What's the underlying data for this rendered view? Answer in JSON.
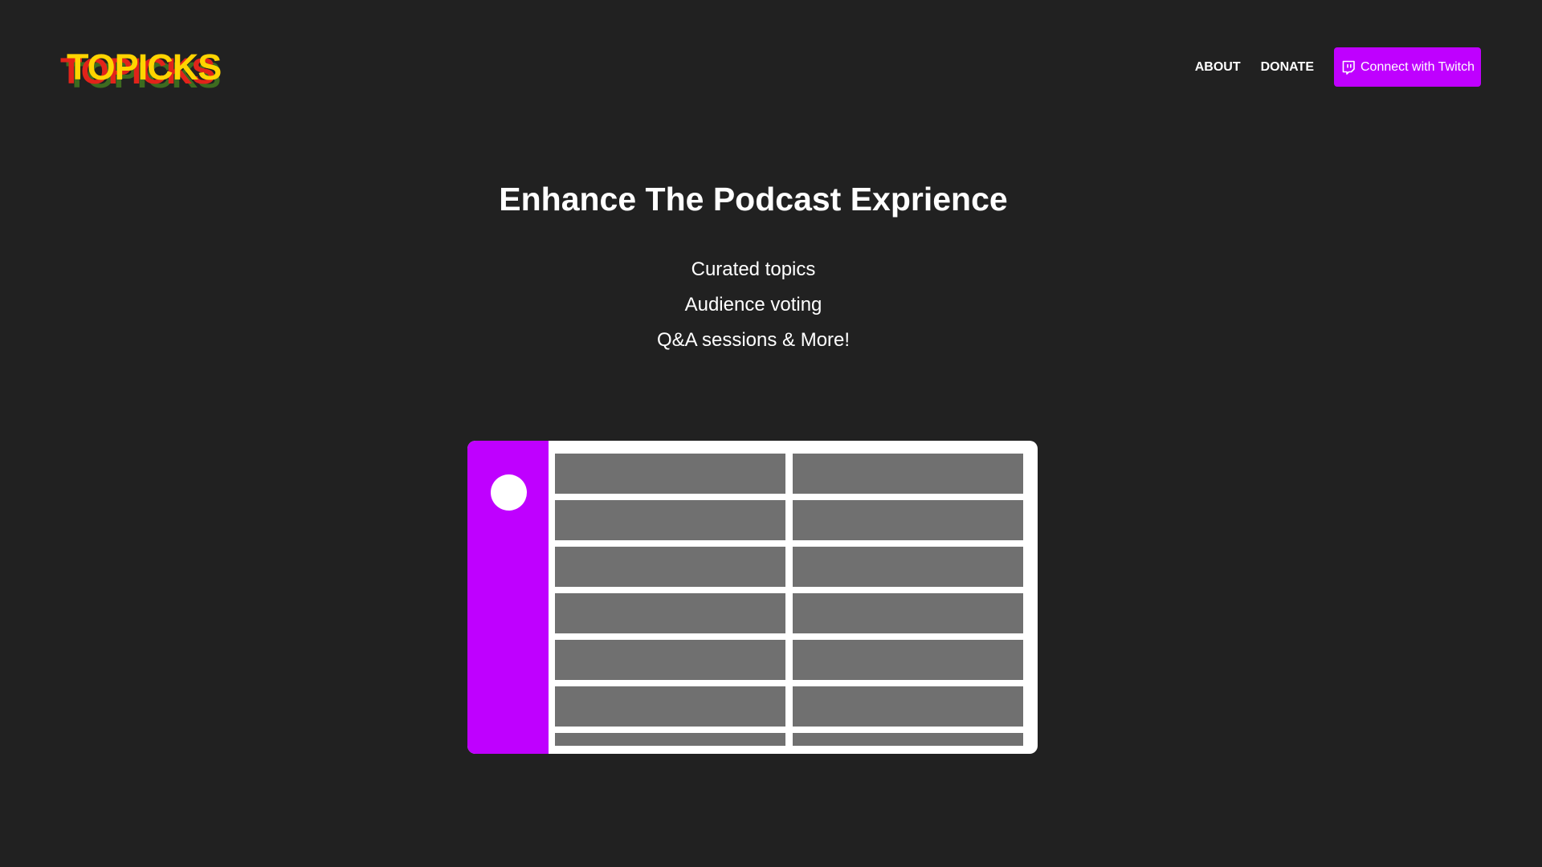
{
  "header": {
    "logo_text": "TOPICKS",
    "logo_colors": [
      "#3d6b1f",
      "#e2231a",
      "#ffd400"
    ],
    "nav": [
      {
        "label": "ABOUT"
      },
      {
        "label": "DONATE"
      }
    ],
    "cta": {
      "label": "Connect with Twitch",
      "icon": "twitch-icon",
      "color": "#bf00ff"
    }
  },
  "hero": {
    "title": "Enhance The Podcast Exprience",
    "features": [
      "Curated topics",
      "Audience voting",
      "Q&A sessions & More!"
    ]
  },
  "illustration": {
    "sidebar_color": "#bf00ff",
    "placeholder_color": "#707070",
    "rows": 7,
    "columns": 2
  },
  "colors": {
    "background": "#212121",
    "text": "#ffffff",
    "accent": "#bf00ff"
  }
}
